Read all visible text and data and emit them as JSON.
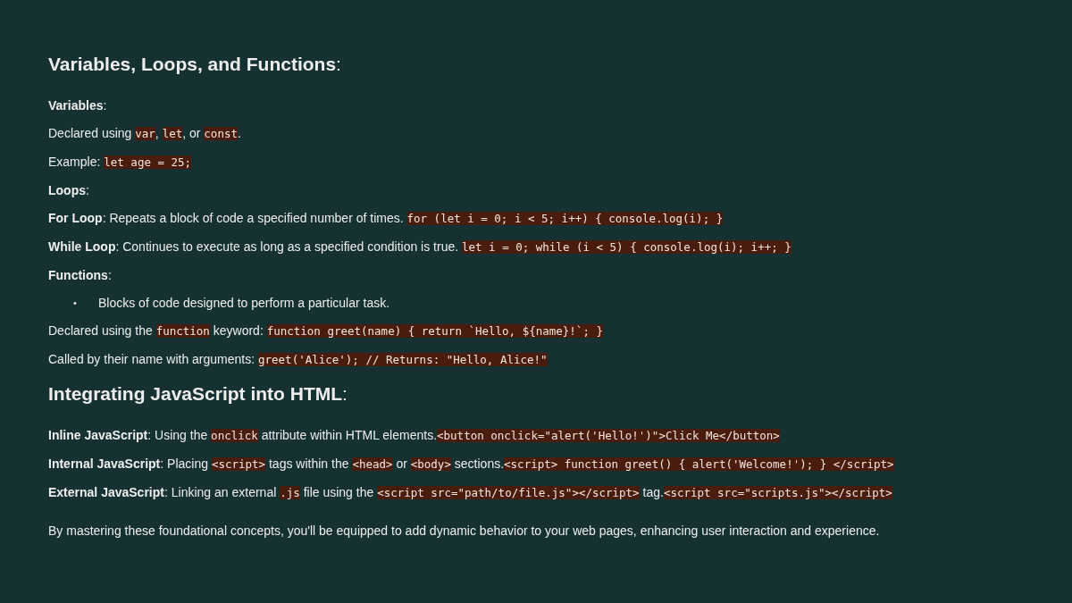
{
  "sections": [
    {
      "heading": "**Variables, Loops, and Functions**:",
      "items": [
        {
          "kind": "paragraph",
          "segments": [
            {
              "kind": "text",
              "text": "**Variables**:"
            }
          ]
        },
        {
          "kind": "paragraph",
          "segments": [
            {
              "kind": "text",
              "text": "Declared using "
            },
            {
              "kind": "code",
              "text": "var"
            },
            {
              "kind": "text",
              "text": ", "
            },
            {
              "kind": "code",
              "text": "let"
            },
            {
              "kind": "text",
              "text": ", or "
            },
            {
              "kind": "code",
              "text": "const"
            },
            {
              "kind": "text",
              "text": "."
            }
          ]
        },
        {
          "kind": "paragraph",
          "segments": [
            {
              "kind": "text",
              "text": "Example: "
            },
            {
              "kind": "code",
              "text": "let age = 25;"
            }
          ]
        },
        {
          "kind": "paragraph",
          "segments": [
            {
              "kind": "text",
              "text": "**Loops**:"
            }
          ]
        },
        {
          "kind": "paragraph",
          "segments": [
            {
              "kind": "text",
              "text": "**For Loop**: Repeats a block of code a specified number of times. "
            },
            {
              "kind": "code",
              "text": "for (let i = 0; i < 5; i++) { console.log(i); }"
            }
          ]
        },
        {
          "kind": "paragraph",
          "segments": [
            {
              "kind": "text",
              "text": "**While Loop**: Continues to execute as long as a specified condition is true. "
            },
            {
              "kind": "code",
              "text": "let i = 0; while (i < 5) { console.log(i); i++; }"
            }
          ]
        },
        {
          "kind": "paragraph",
          "segments": [
            {
              "kind": "text",
              "text": "**Functions**:"
            }
          ]
        },
        {
          "kind": "bullet",
          "bullet": "•",
          "segments": [
            {
              "kind": "text",
              "text": "Blocks of code designed to perform a particular task."
            }
          ]
        },
        {
          "kind": "paragraph",
          "segments": [
            {
              "kind": "text",
              "text": "Declared using the "
            },
            {
              "kind": "code",
              "text": "function"
            },
            {
              "kind": "text",
              "text": " keyword: "
            },
            {
              "kind": "code",
              "text": "function greet(name) { return `Hello, ${name}!`; }"
            }
          ]
        },
        {
          "kind": "paragraph",
          "segments": [
            {
              "kind": "text",
              "text": "Called by their name with arguments: "
            },
            {
              "kind": "code",
              "text": "greet('Alice'); // Returns: \"Hello, Alice!\""
            }
          ]
        }
      ]
    },
    {
      "heading": "**Integrating JavaScript into HTML**:",
      "items": [
        {
          "kind": "paragraph",
          "segments": [
            {
              "kind": "text",
              "text": "**Inline JavaScript**: Using the "
            },
            {
              "kind": "code",
              "text": "onclick"
            },
            {
              "kind": "text",
              "text": " attribute within HTML elements."
            },
            {
              "kind": "code",
              "text": "<button onclick=\"alert('Hello!')\">Click Me</button>"
            }
          ]
        },
        {
          "kind": "paragraph",
          "segments": [
            {
              "kind": "text",
              "text": "**Internal JavaScript**: Placing "
            },
            {
              "kind": "code",
              "text": "<script>"
            },
            {
              "kind": "text",
              "text": " tags within the "
            },
            {
              "kind": "code",
              "text": "<head>"
            },
            {
              "kind": "text",
              "text": " or "
            },
            {
              "kind": "code",
              "text": "<body>"
            },
            {
              "kind": "text",
              "text": " sections."
            },
            {
              "kind": "code",
              "text": "<script> function greet() { alert('Welcome!'); } </script>"
            }
          ]
        },
        {
          "kind": "paragraph",
          "segments": [
            {
              "kind": "text",
              "text": "**External JavaScript**: Linking an external "
            },
            {
              "kind": "code",
              "text": ".js"
            },
            {
              "kind": "text",
              "text": " file using the "
            },
            {
              "kind": "code",
              "text": "<script src=\"path/to/file.js\"></script>"
            },
            {
              "kind": "text",
              "text": " tag."
            },
            {
              "kind": "code",
              "text": "<script src=\"scripts.js\"></script>"
            }
          ]
        }
      ]
    }
  ],
  "closing": "By mastering these foundational concepts, you'll be equipped to add dynamic behavior to your web pages, enhancing user interaction and experience."
}
